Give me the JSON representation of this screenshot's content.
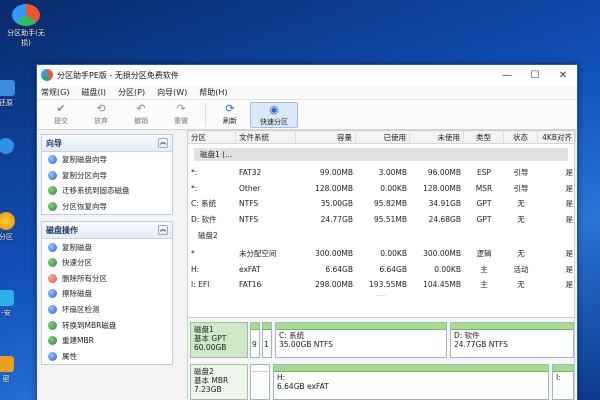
{
  "desktop": {
    "icons": [
      {
        "label": "分区助手(无",
        "label2": "损)",
        "icon": "partition-assistant-icon"
      },
      {
        "label": "还原",
        "icon": "restore-icon"
      },
      {
        "label": "分区",
        "icon": "partition-icon"
      },
      {
        "label": "-安",
        "icon": "install-icon"
      },
      {
        "label": "密",
        "icon": "password-icon"
      }
    ]
  },
  "window": {
    "title": "分区助手PE版 - 无损分区免费软件",
    "controls": {
      "minimize": "—",
      "maximize": "☐",
      "close": "✕"
    }
  },
  "menu": [
    "常规(G)",
    "磁盘(I)",
    "分区(P)",
    "向导(W)",
    "帮助(H)"
  ],
  "toolbar": [
    {
      "label": "提交",
      "icon": "submit-icon",
      "glyph": "✔",
      "enabled": false
    },
    {
      "label": "放弃",
      "icon": "discard-icon",
      "glyph": "⟲",
      "enabled": false
    },
    {
      "label": "撤销",
      "icon": "undo-icon",
      "glyph": "↶",
      "enabled": false
    },
    {
      "label": "重做",
      "icon": "redo-icon",
      "glyph": "↷",
      "enabled": false
    },
    {
      "label": "刷新",
      "icon": "refresh-icon",
      "glyph": "⟳",
      "enabled": true
    },
    {
      "label": "快速分区",
      "icon": "quick-partition-icon",
      "glyph": "◉",
      "enabled": true
    }
  ],
  "sidebar": {
    "wizard": {
      "title": "向导",
      "collapse_glyph": "︽",
      "items": [
        "复制磁盘向导",
        "复制分区向导",
        "迁移系统到固态磁盘",
        "分区恢复向导"
      ]
    },
    "disk_ops": {
      "title": "磁盘操作",
      "collapse_glyph": "︽",
      "items": [
        "复制磁盘",
        "快速分区",
        "删除所有分区",
        "擦除磁盘",
        "坏扇区检测",
        "转换到MBR磁盘",
        "重建MBR",
        "属性"
      ]
    }
  },
  "table": {
    "columns": [
      "分区",
      "文件系统",
      "容量",
      "已使用",
      "未使用",
      "类型",
      "状态",
      "4KB对齐"
    ],
    "disks": [
      {
        "name": "磁盘1 (...",
        "rows": [
          [
            "*:",
            "FAT32",
            "99.00MB",
            "3.00MB",
            "96.00MB",
            "ESP",
            "引导",
            "是"
          ],
          [
            "*:",
            "Other",
            "128.00MB",
            "0.00KB",
            "128.00MB",
            "MSR",
            "引导",
            "是"
          ],
          [
            "C: 系统",
            "NTFS",
            "35.00GB",
            "95.82MB",
            "34.91GB",
            "GPT",
            "无",
            "是"
          ],
          [
            "D: 软件",
            "NTFS",
            "24.77GB",
            "95.51MB",
            "24.68GB",
            "GPT",
            "无",
            "是"
          ]
        ]
      },
      {
        "name": "磁盘2",
        "rows": [
          [
            "*",
            "未分配空间",
            "300.00MB",
            "0.00KB",
            "300.00MB",
            "逻辑",
            "无",
            "是"
          ],
          [
            "H:",
            "exFAT",
            "6.64GB",
            "6.64GB",
            "0.00KB",
            "主",
            "活动",
            "是"
          ],
          [
            "I: EFI",
            "FAT16",
            "298.00MB",
            "193.55MB",
            "104.45MB",
            "主",
            "无",
            "是"
          ]
        ]
      }
    ],
    "splitter_glyph": "....."
  },
  "disk_map": {
    "disk1": {
      "label": "磁盘1",
      "type": "基本 GPT",
      "size": "60.00GB",
      "blocks": [
        {
          "label": "9",
          "sub": ""
        },
        {
          "label": "1",
          "sub": ""
        },
        {
          "label": "C: 系统",
          "sub": "35.00GB NTFS"
        },
        {
          "label": "D: 软件",
          "sub": "24.77GB NTFS"
        }
      ]
    },
    "disk2": {
      "label": "磁盘2",
      "type": "基本 MBR",
      "size": "7.23GB",
      "blocks": [
        {
          "label": "",
          "sub": ""
        },
        {
          "label": "H:",
          "sub": "6.64GB exFAT"
        },
        {
          "label": "I:",
          "sub": ""
        }
      ]
    }
  }
}
